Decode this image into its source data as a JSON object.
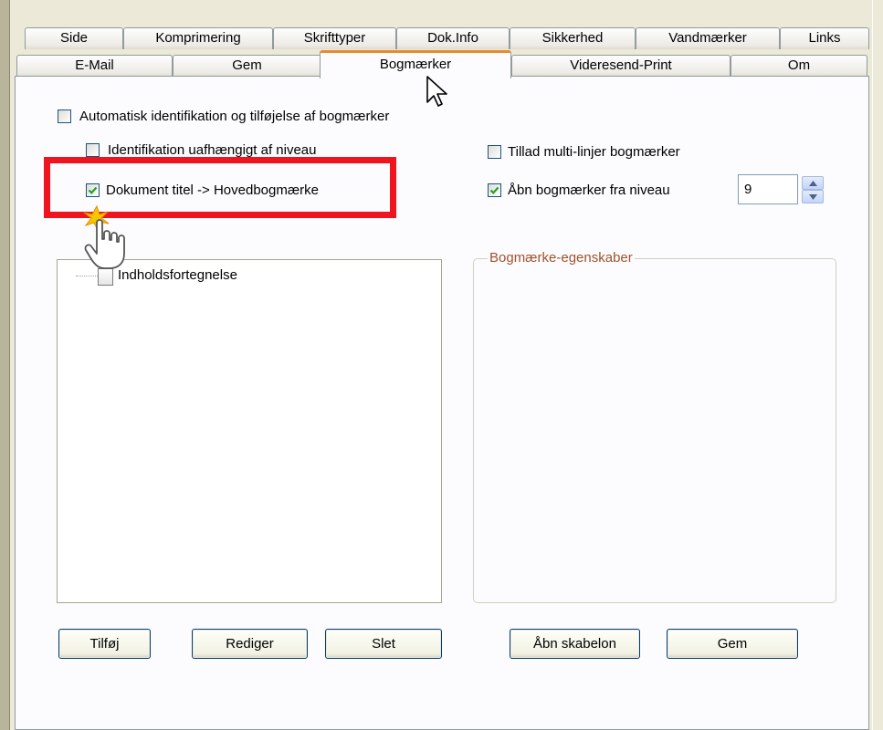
{
  "tabs_row1": [
    "Side",
    "Komprimering",
    "Skrifttyper",
    "Dok.Info",
    "Sikkerhed",
    "Vandmærker",
    "Links"
  ],
  "tabs_row2": [
    "E-Mail",
    "Gem",
    "Bogmærker",
    "Videresend-Print",
    "Om"
  ],
  "active_tab": "Bogmærker",
  "options": {
    "auto_identify": {
      "label": "Automatisk identifikation og tilføjelse af bogmærker",
      "checked": false
    },
    "level_independent": {
      "label": "Identifikation uafhængigt af niveau",
      "checked": false
    },
    "doc_title": {
      "label": "Dokument titel -> Hovedbogmærke",
      "checked": true
    },
    "multiline": {
      "label": "Tillad multi-linjer bogmærker",
      "checked": false
    },
    "open_level": {
      "label": "Åbn bogmærker fra niveau",
      "checked": true
    }
  },
  "level_value": "9",
  "tree": {
    "root_label": "Indholdsfortegnelse"
  },
  "properties_group_title": "Bogmærke-egenskaber",
  "buttons": {
    "add": "Tilføj",
    "edit": "Rediger",
    "delete": "Slet",
    "open_template": "Åbn skabelon",
    "save": "Gem"
  },
  "colors": {
    "highlight": "#f0141e",
    "active_tab_accent": "#e68b2c",
    "group_title": "#a0522d"
  }
}
